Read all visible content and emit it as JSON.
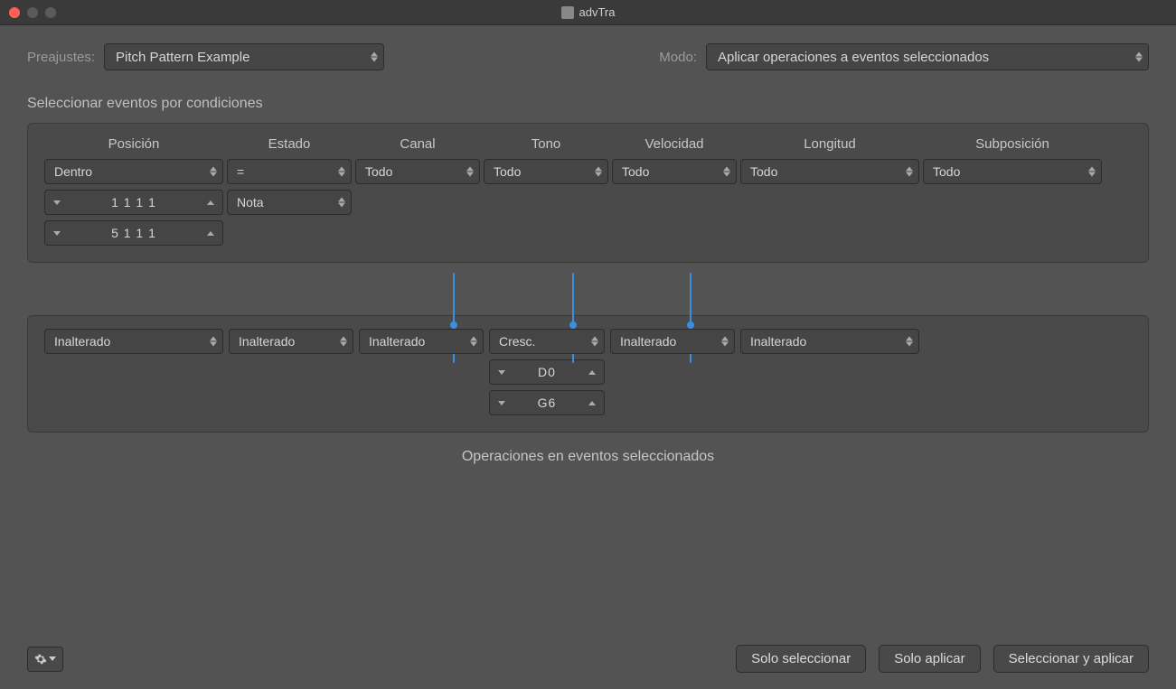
{
  "window": {
    "title": "advTra"
  },
  "top": {
    "presets_label": "Preajustes:",
    "preset_value": "Pitch Pattern Example",
    "mode_label": "Modo:",
    "mode_value": "Aplicar operaciones a eventos seleccionados"
  },
  "conditions": {
    "heading": "Seleccionar eventos por condiciones",
    "headers": {
      "position": "Posición",
      "state": "Estado",
      "channel": "Canal",
      "tone": "Tono",
      "velocity": "Velocidad",
      "length": "Longitud",
      "subposition": "Subposición"
    },
    "row": {
      "position": "Dentro",
      "state": "=",
      "channel": "Todo",
      "tone": "Todo",
      "velocity": "Todo",
      "length": "Todo",
      "subposition": "Todo"
    },
    "position_vals": {
      "v1": "1 1 1    1",
      "v2": "5 1 1    1"
    },
    "state_type": "Nota"
  },
  "operations": {
    "position": "Inalterado",
    "channel": "Inalterado",
    "tone": "Inalterado",
    "velocity": "Cresc.",
    "length": "Inalterado",
    "subposition": "Inalterado",
    "tone_extra": {
      "v1": "D0",
      "v2": "G6"
    },
    "caption": "Operaciones en eventos seleccionados"
  },
  "footer": {
    "solo_seleccionar": "Solo seleccionar",
    "solo_aplicar": "Solo aplicar",
    "seleccionar_y_aplicar": "Seleccionar y aplicar"
  }
}
